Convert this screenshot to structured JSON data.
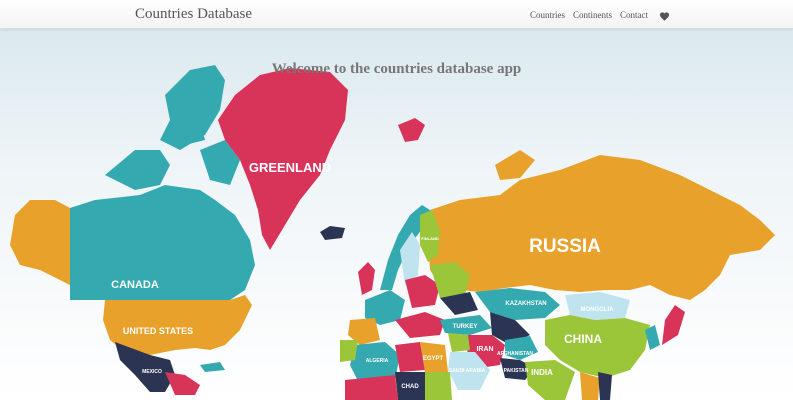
{
  "navbar": {
    "brand": "Countries Database",
    "links": [
      {
        "label": "Countries"
      },
      {
        "label": "Continents"
      },
      {
        "label": "Contact"
      }
    ],
    "favorites_icon": "heart-icon"
  },
  "hero": {
    "welcome": "Welcome to the countries database app"
  },
  "map": {
    "labels": {
      "greenland": "GREENLAND",
      "canada": "CANADA",
      "united_states": "UNITED STATES",
      "mexico": "MEXICO",
      "russia": "RUSSIA",
      "kazakhstan": "KAZAKHSTAN",
      "mongolia": "MONGOLIA",
      "china": "CHINA",
      "india": "INDIA",
      "iran": "IRAN",
      "pakistan": "PAKISTAN",
      "turkey": "TURKEY",
      "saudi_arabia": "SAUDI ARABIA",
      "egypt": "EGYPT",
      "algeria": "ALGERIA",
      "chad": "CHAD",
      "afghanistan": "AFGHANISTAN",
      "finland": "FINLAND"
    },
    "colors": {
      "orange": "#e8a12a",
      "teal": "#35a9b0",
      "crimson": "#d8345a",
      "lime": "#9cc63a",
      "navy": "#2b3553",
      "sky": "#bfe4f0"
    }
  }
}
